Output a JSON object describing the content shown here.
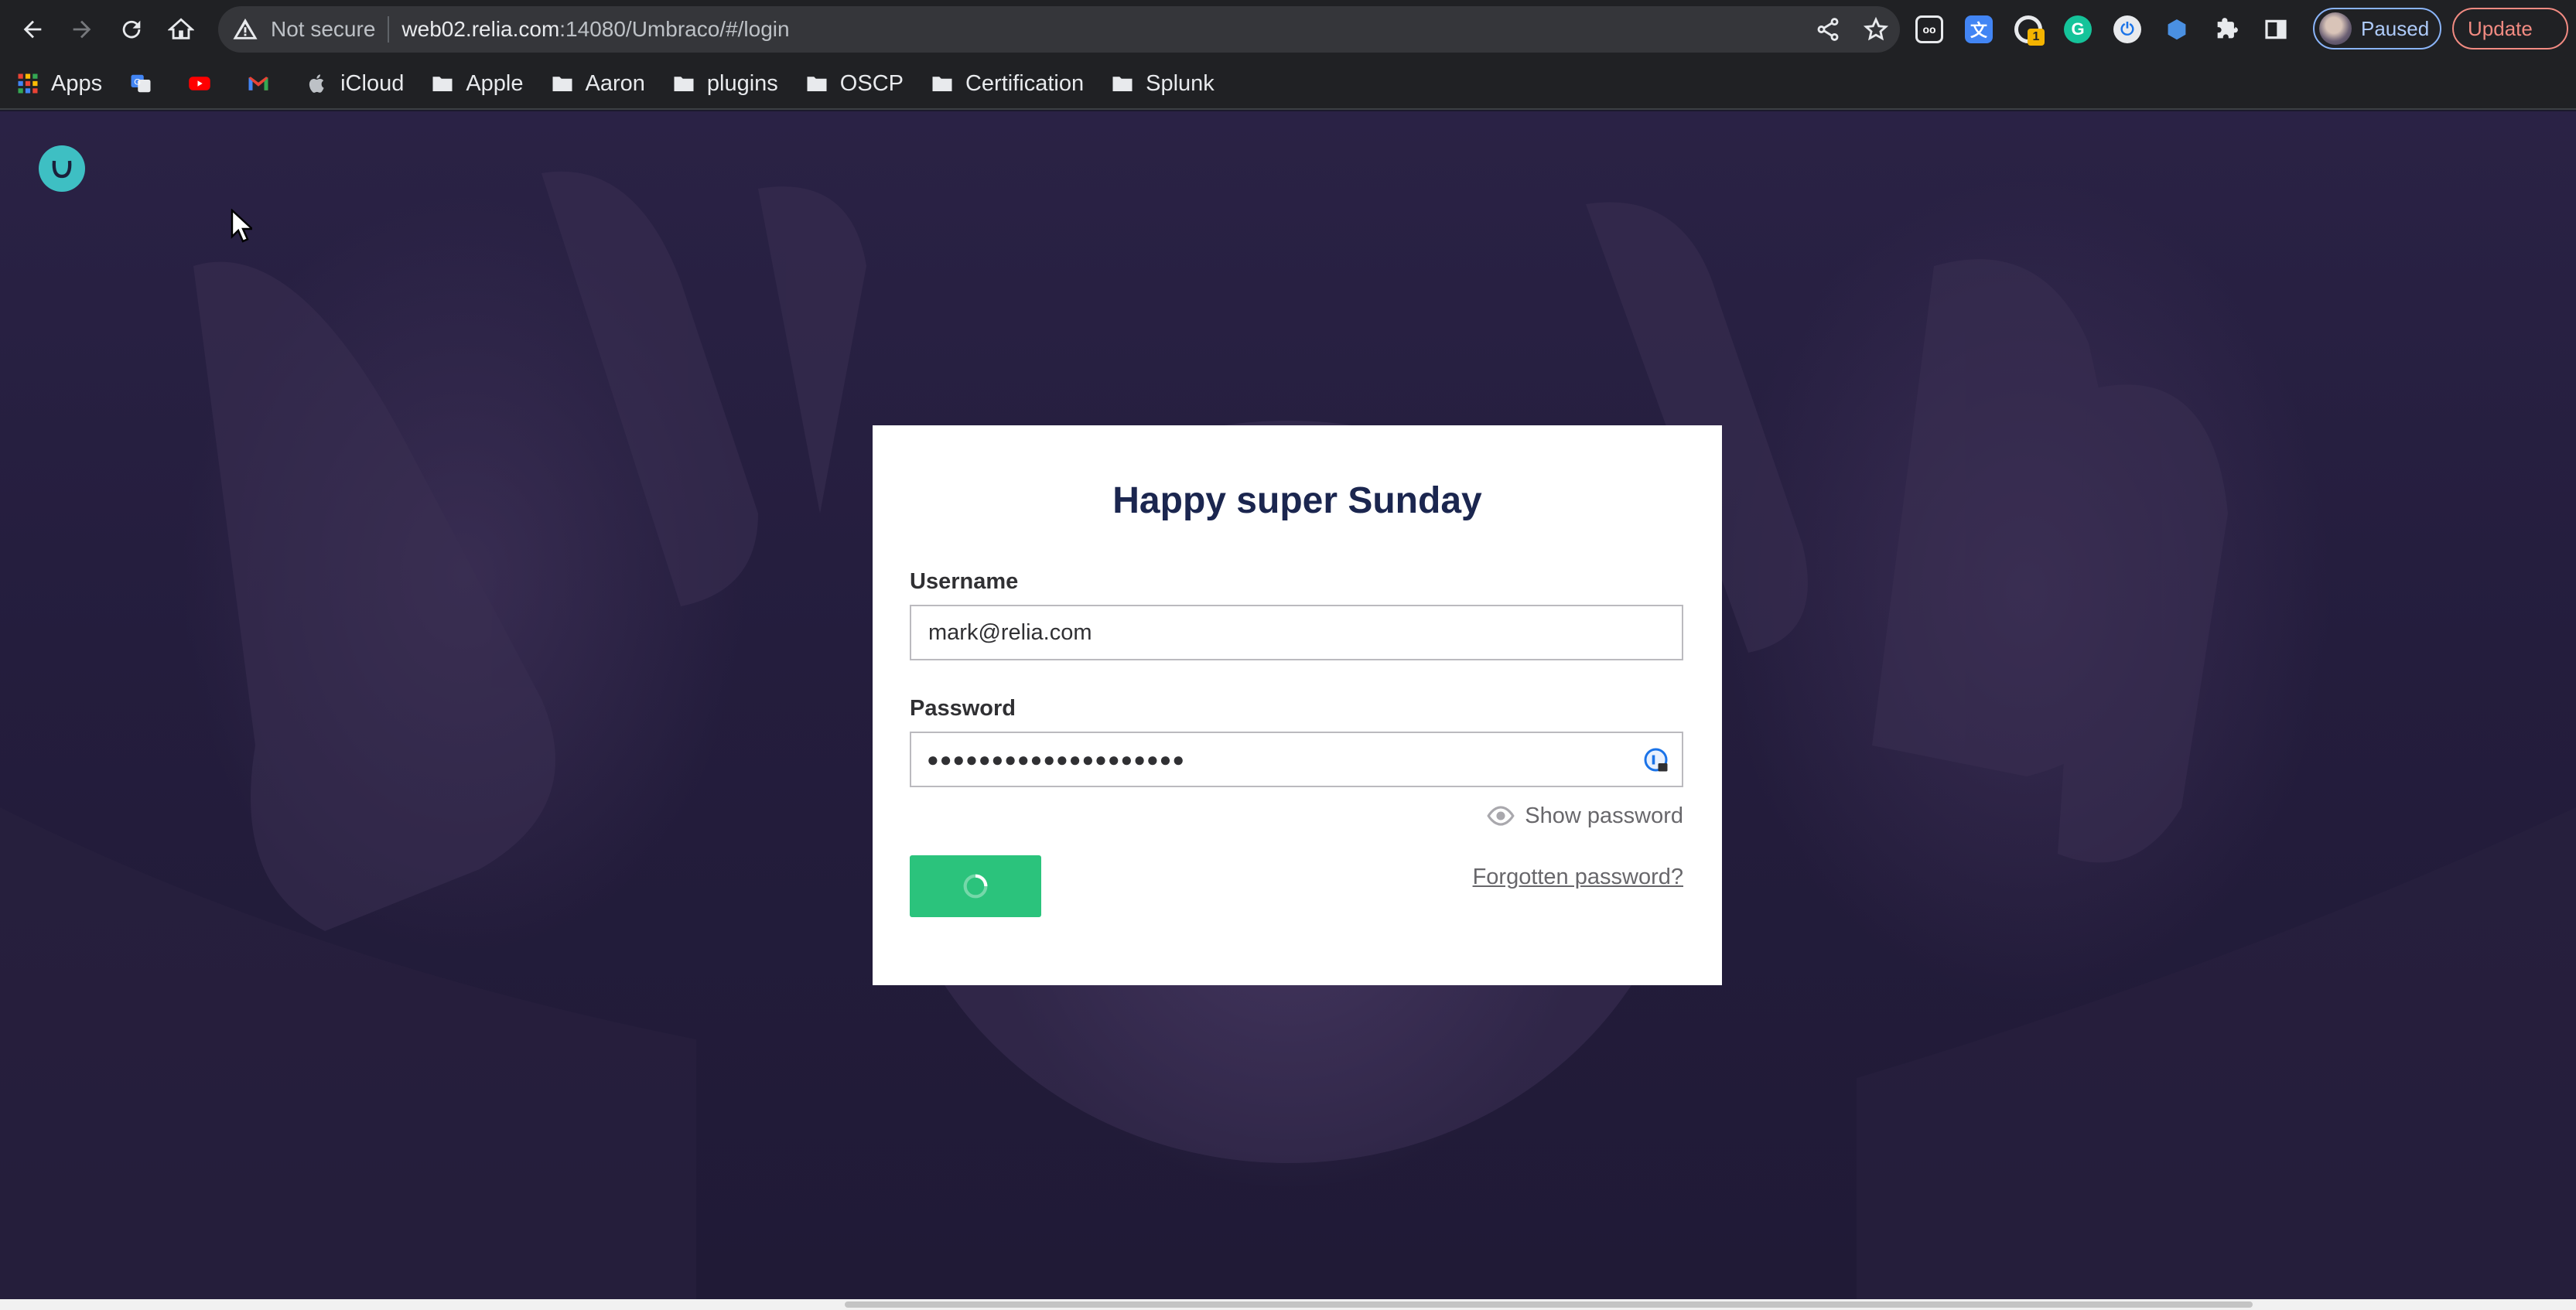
{
  "browser": {
    "security_label": "Not secure",
    "url_host": "web02.relia.com",
    "url_rest": ":14080/Umbraco/#/login",
    "profile_label": "Paused",
    "update_label": "Update",
    "extension_badge": "1"
  },
  "bookmarks": {
    "apps": "Apps",
    "items": [
      "iCloud",
      "Apple",
      "Aaron",
      "plugins",
      "OSCP",
      "Certification",
      "Splunk"
    ]
  },
  "login": {
    "title": "Happy super Sunday",
    "username_label": "Username",
    "username_value": "mark@relia.com",
    "password_label": "Password",
    "password_mask": "●●●●●●●●●●●●●●●●●●●●",
    "show_password": "Show password",
    "forgot_password": "Forgotten password?"
  },
  "colors": {
    "accent_button": "#2bc37c",
    "logo": "#3ebfc3",
    "title_text": "#1b264f"
  }
}
